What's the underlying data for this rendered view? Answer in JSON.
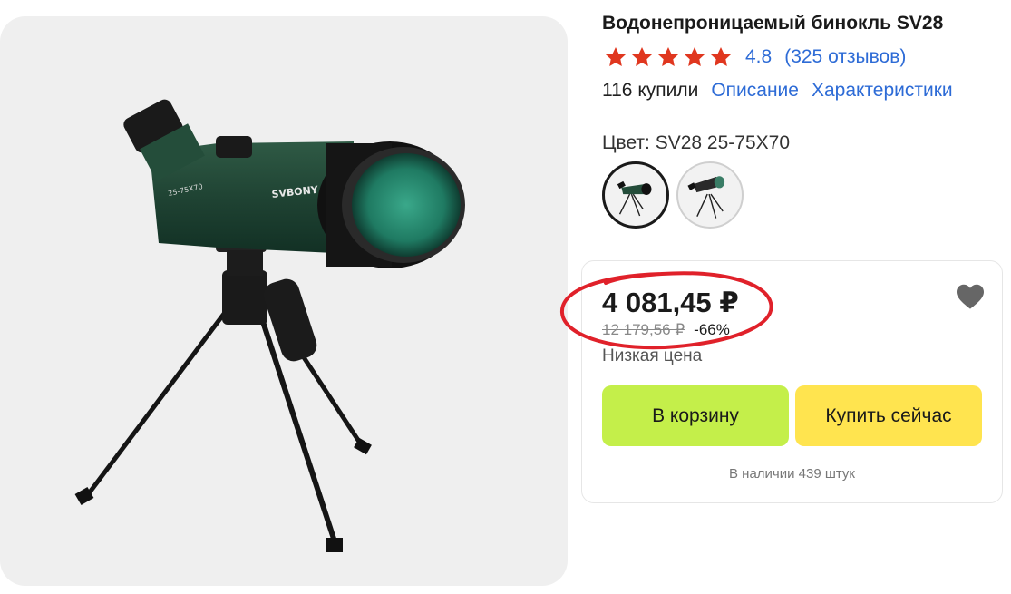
{
  "product": {
    "title": "Водонепроницаемый бинокль SV28",
    "image_label": "SVBONY",
    "image_model_label": "25-75X70"
  },
  "rating": {
    "stars": 5,
    "value": "4.8",
    "reviews": "(325 отзывов)",
    "star_color": "#e0371f"
  },
  "meta": {
    "purchases": "116 купили",
    "links": [
      "Описание",
      "Характеристики"
    ]
  },
  "color": {
    "label": "Цвет: SV28 25-75X70",
    "selected_index": 0,
    "swatch_count": 2
  },
  "price": {
    "current": "4 081,45 ₽",
    "old": "12 179,56 ₽",
    "discount": "-66%",
    "tag": "Низкая цена"
  },
  "actions": {
    "add_to_cart": "В корзину",
    "buy_now": "Купить сейчас"
  },
  "stock": "В наличии 439 штук",
  "colors": {
    "link": "#2d6bd6",
    "cart_button": "#c4ef4a",
    "buy_button": "#ffe44f",
    "annotation": "#e0212a",
    "heart": "#666666"
  },
  "icons": [
    "star-icon",
    "heart-icon"
  ]
}
